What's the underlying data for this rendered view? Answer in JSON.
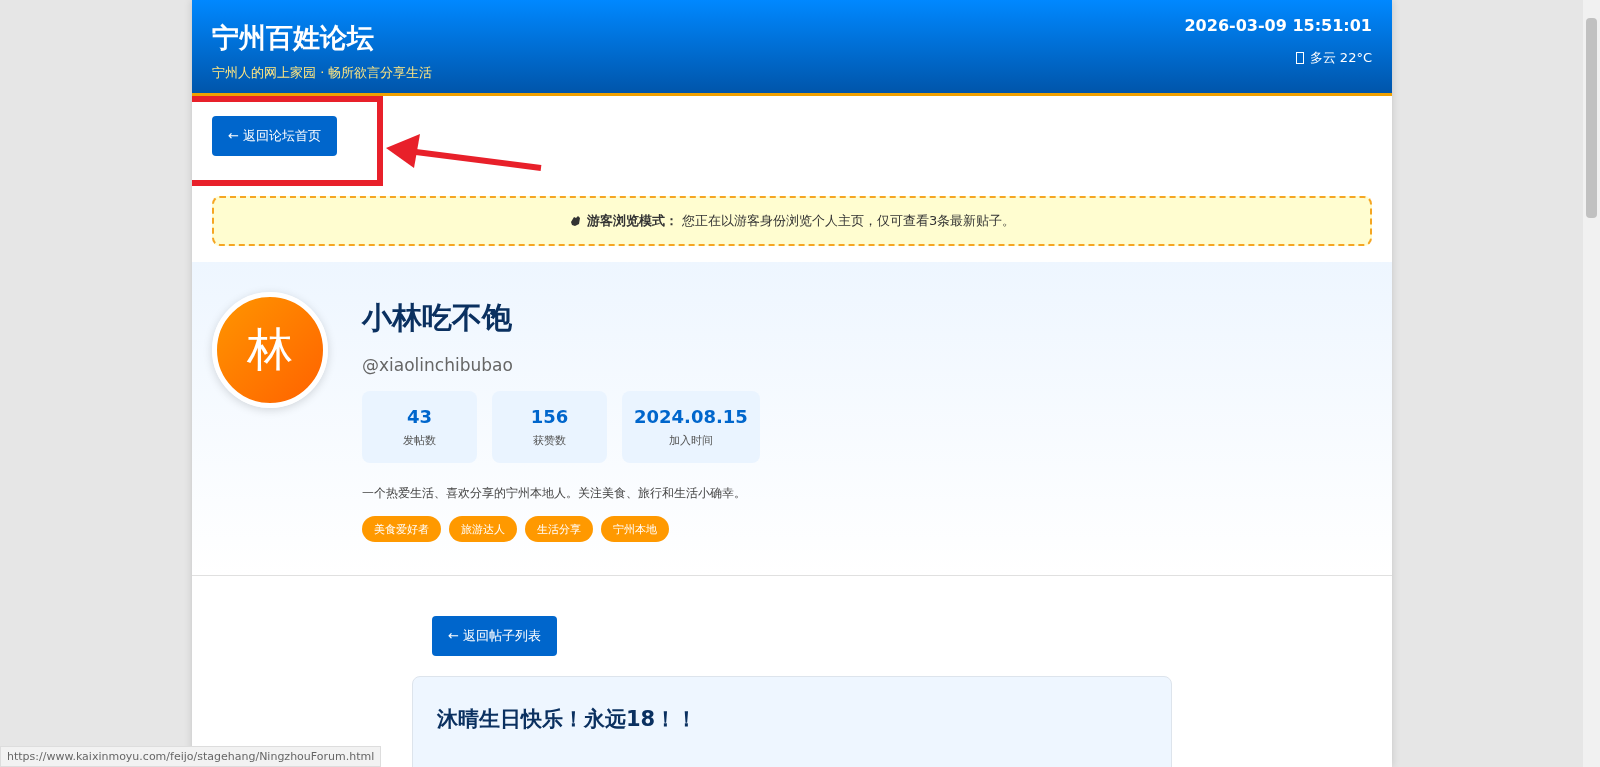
{
  "header": {
    "title": "宁州百姓论坛",
    "subtitle": "宁州人的网上家园 · 畅所欲言分享生活",
    "datetime": "2026-03-09 15:51:01",
    "weather": "多云 22°C"
  },
  "back_button": "← 返回论坛首页",
  "notice": {
    "label": "游客浏览模式：",
    "text": "您正在以游客身份浏览个人主页，仅可查看3条最新贴子。"
  },
  "profile": {
    "avatar": "林",
    "name": "小林吃不饱",
    "handle": "@xiaolinchibubao",
    "stats": [
      {
        "value": "43",
        "label": "发帖数"
      },
      {
        "value": "156",
        "label": "获赞数"
      },
      {
        "value": "2024.08.15",
        "label": "加入时间"
      }
    ],
    "bio": "一个热爱生活、喜欢分享的宁州本地人。关注美食、旅行和生活小确幸。",
    "tags": [
      "美食爱好者",
      "旅游达人",
      "生活分享",
      "宁州本地"
    ]
  },
  "post_back_button": "← 返回帖子列表",
  "post": {
    "title": "沐晴生日快乐！永远18！！"
  },
  "status_bar": {
    "url": "https://www.kaixinmoyu.com/feijo/stagehang/NingzhouForum.html"
  }
}
